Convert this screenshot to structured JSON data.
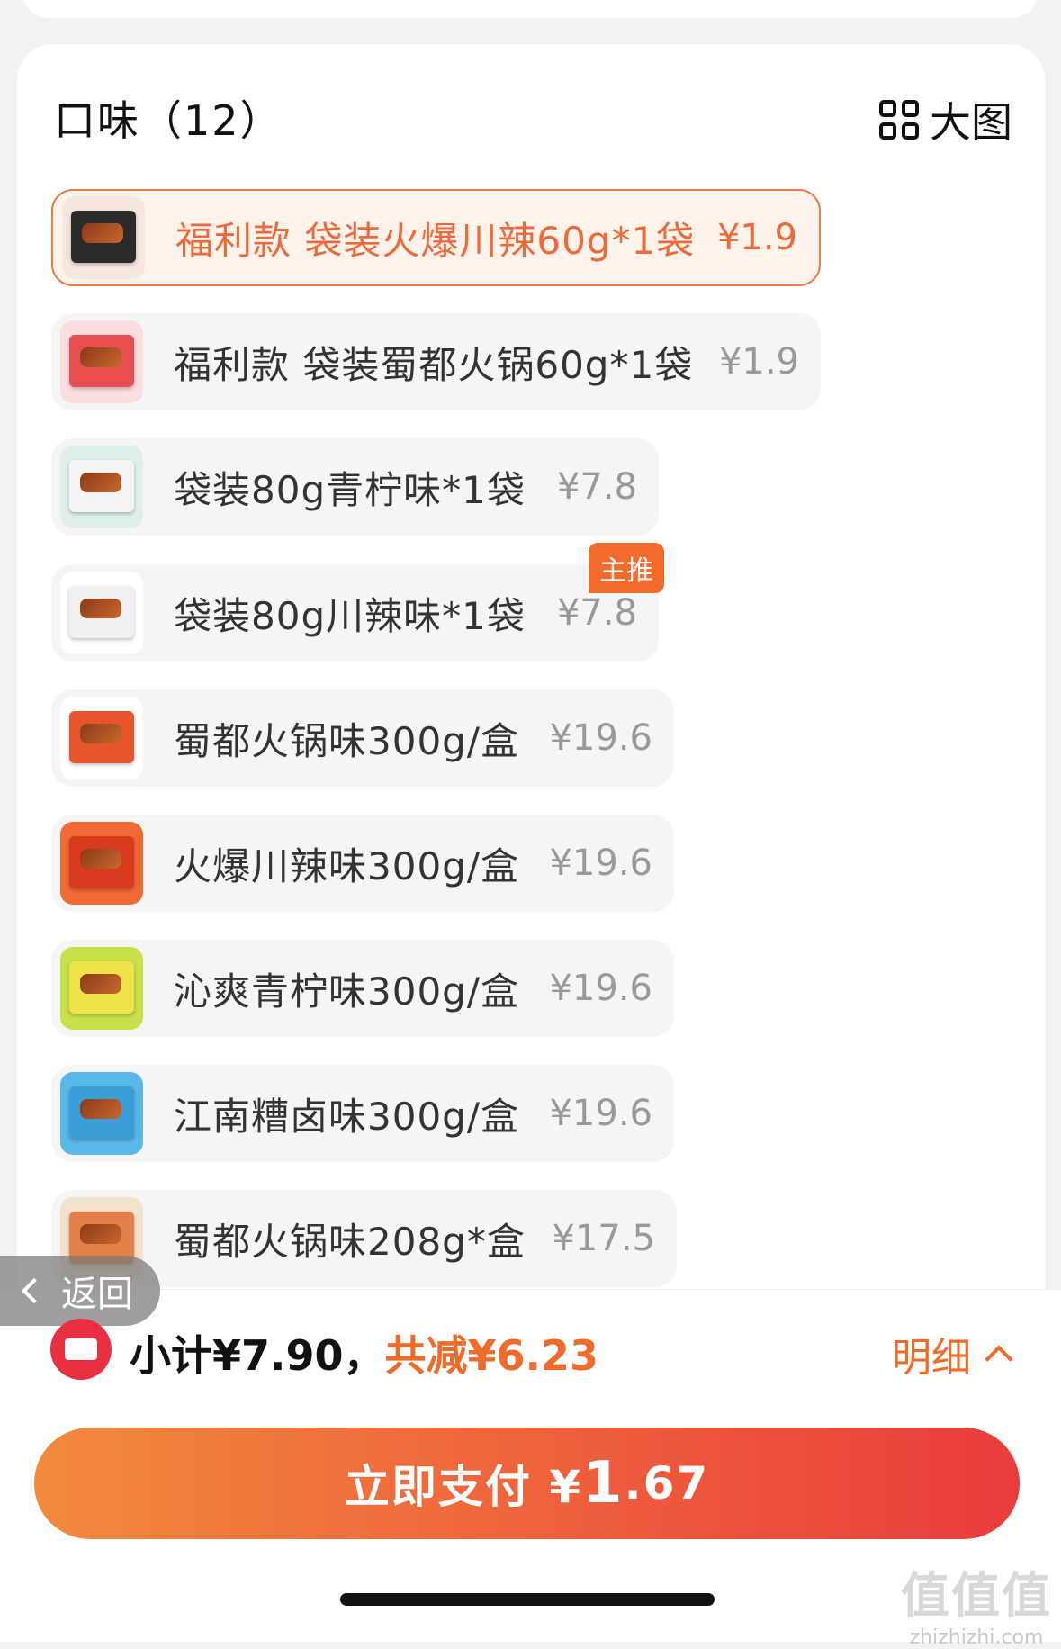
{
  "section": {
    "title": "口味（12）",
    "big_image_label": "大图"
  },
  "options": [
    {
      "label": "福利款 袋装火爆川辣60g*1袋",
      "price": "¥1.9",
      "selected": true
    },
    {
      "label": "福利款 袋装蜀都火锅60g*1袋",
      "price": "¥1.9"
    },
    {
      "label": "袋装80g青柠味*1袋",
      "price": "¥7.8"
    },
    {
      "label": "袋装80g川辣味*1袋",
      "price": "¥7.8",
      "badge": "主推"
    },
    {
      "label": "蜀都火锅味300g/盒",
      "price": "¥19.6"
    },
    {
      "label": "火爆川辣味300g/盒",
      "price": "¥19.6"
    },
    {
      "label": "沁爽青柠味300g/盒",
      "price": "¥19.6"
    },
    {
      "label": "江南糟卤味300g/盒",
      "price": "¥19.6"
    },
    {
      "label": "蜀都火锅味208g*盒",
      "price": "¥17.5"
    }
  ],
  "back_label": "返回",
  "summary": {
    "subtotal": "小计¥7.90，",
    "discount": "共减¥6.23",
    "detail_label": "明细"
  },
  "pay": {
    "label": "立即支付 ¥",
    "amount_int": "1",
    "amount_dec": ".67"
  },
  "watermark": {
    "big": "值值值",
    "small": "zhizhizhi.com"
  },
  "colors": {
    "accent": "#f06a2a",
    "pay_start": "#f28a3c",
    "pay_end": "#ea3c3c",
    "coupon": "#e83040"
  }
}
